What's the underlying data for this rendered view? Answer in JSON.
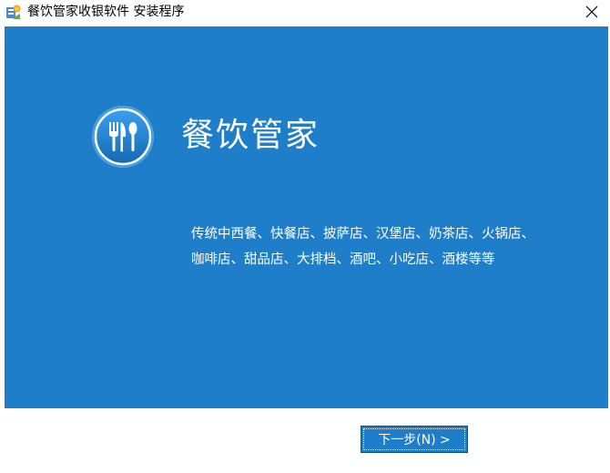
{
  "window": {
    "title": "餐饮管家收银软件 安装程序",
    "close_icon": "close-icon",
    "app_icon": "installer-app-icon"
  },
  "banner": {
    "background_color": "#1f7ec9",
    "logo_icon": "utensils-logo-icon",
    "product_name": "餐饮管家",
    "description_lines": [
      "传统中西餐、快餐店、披萨店、汉堡店、奶茶店、火锅店、",
      "咖啡店、甜品店、大排档、酒吧、小吃店、酒楼等等"
    ]
  },
  "footer": {
    "next_button_label": "下一步(N) >"
  }
}
